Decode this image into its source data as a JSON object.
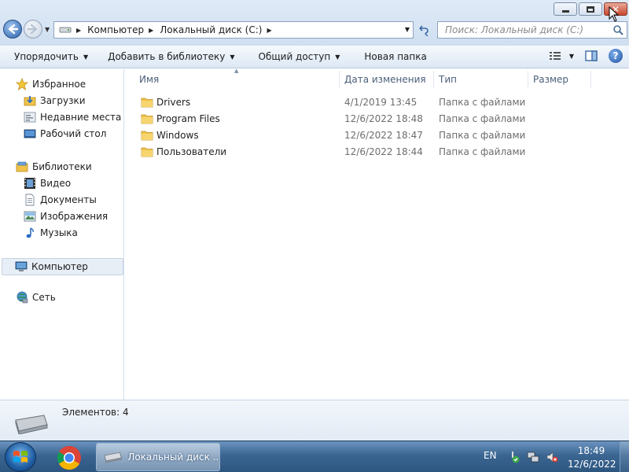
{
  "window": {
    "controls": {
      "minimize_icon": "minimize-icon",
      "maximize_icon": "maximize-icon",
      "close_icon": "close-icon"
    }
  },
  "address_bar": {
    "breadcrumbs": [
      "Компьютер",
      "Локальный диск (C:)"
    ]
  },
  "search": {
    "placeholder": "Поиск: Локальный диск (C:)"
  },
  "toolbar": {
    "organize": "Упорядочить",
    "add_to_library": "Добавить в библиотеку",
    "share": "Общий доступ",
    "new_folder": "Новая папка"
  },
  "nav": {
    "favorites": "Избранное",
    "downloads": "Загрузки",
    "recent": "Недавние места",
    "desktop": "Рабочий стол",
    "libraries": "Библиотеки",
    "video": "Видео",
    "documents": "Документы",
    "pictures": "Изображения",
    "music": "Музыка",
    "computer": "Компьютер",
    "network": "Сеть"
  },
  "columns": {
    "name": "Имя",
    "date": "Дата изменения",
    "type": "Тип",
    "size": "Размер"
  },
  "files": [
    {
      "name": "Drivers",
      "date": "4/1/2019 13:45",
      "type": "Папка с файлами"
    },
    {
      "name": "Program Files",
      "date": "12/6/2022 18:48",
      "type": "Папка с файлами"
    },
    {
      "name": "Windows",
      "date": "12/6/2022 18:47",
      "type": "Папка с файлами"
    },
    {
      "name": "Пользователи",
      "date": "12/6/2022 18:44",
      "type": "Папка с файлами"
    }
  ],
  "details": {
    "item_count": "Элементов: 4"
  },
  "taskbar": {
    "window_label": "Локальный диск ...",
    "lang": "EN",
    "time": "18:49",
    "date": "12/6/2022"
  },
  "colors": {
    "accent": "#3b6592",
    "close_red": "#c9462c",
    "folder_yellow": "#f0c24a"
  }
}
